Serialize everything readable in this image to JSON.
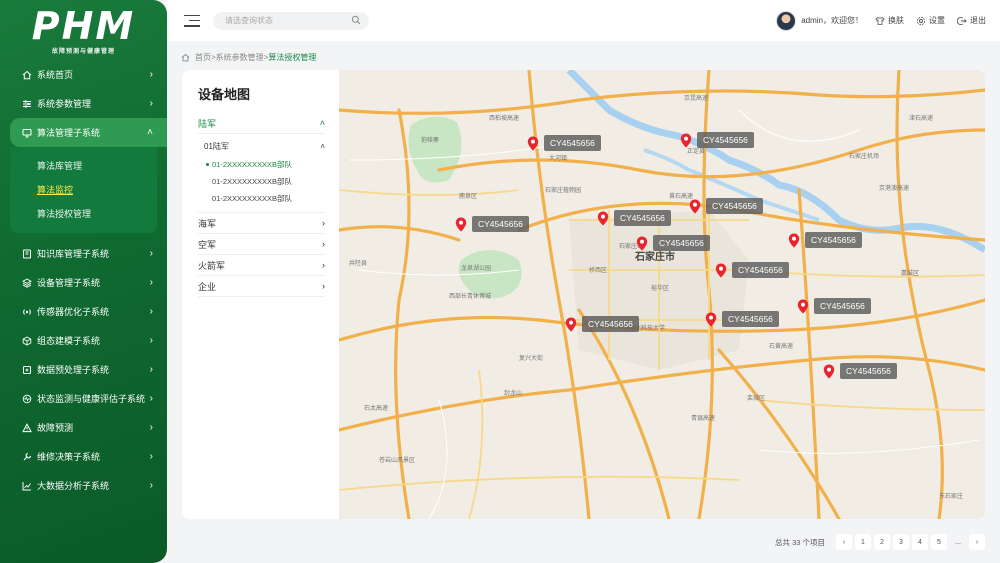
{
  "app": {
    "logo": "PHM",
    "logo_subtitle": "故障预测与健康管理"
  },
  "sidebar": {
    "items": [
      {
        "label": "系统首页",
        "icon": "home-icon"
      },
      {
        "label": "系统参数管理",
        "icon": "sliders-icon"
      },
      {
        "label": "算法管理子系统",
        "icon": "monitor-icon",
        "active": true,
        "children": [
          {
            "label": "算法库管理"
          },
          {
            "label": "算法监控",
            "current": true
          },
          {
            "label": "算法授权管理"
          }
        ]
      },
      {
        "label": "知识库管理子系统",
        "icon": "book-icon"
      },
      {
        "label": "设备管理子系统",
        "icon": "layers-icon"
      },
      {
        "label": "传感器优化子系统",
        "icon": "signal-icon"
      },
      {
        "label": "组态建模子系统",
        "icon": "cube-icon"
      },
      {
        "label": "数据预处理子系统",
        "icon": "data-icon"
      },
      {
        "label": "状态监测与健康评估子系统",
        "icon": "pulse-icon"
      },
      {
        "label": "故障预测",
        "icon": "warning-icon"
      },
      {
        "label": "维修决策子系统",
        "icon": "wrench-icon"
      },
      {
        "label": "大数据分析子系统",
        "icon": "chart-icon"
      }
    ]
  },
  "topbar": {
    "search_placeholder": "请选查询状态",
    "user_greeting": "admin，欢迎您！",
    "skin_label": "换肤",
    "settings_label": "设置",
    "logout_label": "退出"
  },
  "breadcrumb": {
    "home": "首页",
    "sep1": ">",
    "level1": "系统参数管理",
    "sep2": ">",
    "current": "算法授权管理"
  },
  "tree": {
    "title": "设备地图",
    "groups": [
      {
        "label": "陆军",
        "open": true
      },
      {
        "label": "海军"
      },
      {
        "label": "空军"
      },
      {
        "label": "火箭军"
      },
      {
        "label": "企业"
      }
    ],
    "subgroup": "01陆军",
    "leaves": [
      "01-2XXXXXXXXXB部队",
      "01-2XXXXXXXXXB部队",
      "01-2XXXXXXXXXB部队"
    ]
  },
  "map": {
    "city_label": "石家庄市",
    "places": [
      "藁城区",
      "栾城区",
      "新华区",
      "长安区",
      "桥西区",
      "裕华区",
      "井陉县",
      "鹿泉区",
      "正定县",
      "石家庄站",
      "大河镇",
      "封龙山",
      "龙泉湖公园",
      "西部长青休博城",
      "抱犊寨",
      "石家庄植物园",
      "天山生态园",
      "苍岩山风景区",
      "河北科技大学",
      "石家庄机场",
      "东石家庄"
    ],
    "roads": [
      "京昆高速",
      "黄石高速",
      "石黄高速",
      "青银高速",
      "京港澳高速",
      "石太高速",
      "津石高速",
      "西柏坡高速",
      "复兴大街"
    ],
    "markers": [
      "CY4545656",
      "CY4545656",
      "CY4545656",
      "CY4545656",
      "CY4545656",
      "CY4545656",
      "CY4545656",
      "CY4545656",
      "CY4545656",
      "CY4545656",
      "CY4545656"
    ]
  },
  "pagination": {
    "total_label": "总共 33 个项目",
    "pages": [
      "1",
      "2",
      "3",
      "4",
      "5"
    ],
    "ellipsis": "...",
    "prev": "‹",
    "next": "›"
  },
  "colors": {
    "primary": "#1a7a3c",
    "accent": "#1a8a44",
    "highlight": "#ffe94a",
    "pin": "#e8252e"
  }
}
